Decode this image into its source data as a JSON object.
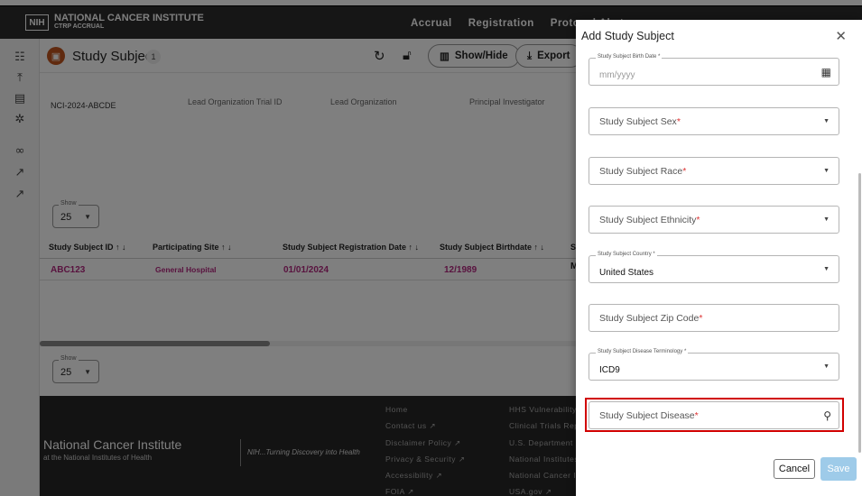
{
  "topbar": {
    "logo_box": "NIH",
    "logo_line1": "NATIONAL CANCER INSTITUTE",
    "logo_line2": "CTRP ACCRUAL",
    "nav": [
      "Accrual",
      "Registration",
      "Protocol Abst"
    ]
  },
  "sidebar_icons": [
    "search-list-icon",
    "upload-icon",
    "document-icon",
    "bug-icon",
    "link-icon",
    "external-link-icon",
    "external-link-icon"
  ],
  "subheader": {
    "title": "Study Subject",
    "count": "1",
    "show_hide": "Show/Hide",
    "export": "Export"
  },
  "trial_meta": {
    "trial_id": "NCI-2024-ABCDE",
    "labels": [
      "Lead Organization Trial ID",
      "Lead Organization",
      "Principal Investigator"
    ]
  },
  "show_control": {
    "label": "Show",
    "value": "25"
  },
  "table": {
    "headers": [
      "Study Subject ID",
      "Participating Site",
      "Study Subject Registration Date",
      "Study Subject Birthdate",
      "St"
    ],
    "rows": [
      [
        "ABC123",
        "General Hospital",
        "01/01/2024",
        "12/1989",
        "M"
      ]
    ]
  },
  "footer": {
    "title": "National Cancer Institute",
    "subtitle": "at the National Institutes of Health",
    "tagline": "NIH...Turning Discovery into Health",
    "col1": [
      "Home",
      "Contact us",
      "Disclaimer Policy",
      "Privacy & Security",
      "Accessibility",
      "FOIA"
    ],
    "col2": [
      "HHS Vulnerability",
      "Clinical Trials Rep",
      "U.S. Department o",
      "National Institutes",
      "National Cancer In",
      "USA.gov"
    ]
  },
  "dialog": {
    "title": "Add Study Subject",
    "birth_date": {
      "label": "Study Subject Birth Date *",
      "placeholder": "mm/yyyy"
    },
    "sex": "Study Subject Sex",
    "race": "Study Subject Race",
    "ethnicity": "Study Subject Ethnicity",
    "country": {
      "label": "Study Subject Country *",
      "value": "United States"
    },
    "zip": "Study Subject Zip Code",
    "terminology": {
      "label": "Study Subject Disease Terminology *",
      "value": "ICD9"
    },
    "disease": "Study Subject Disease",
    "required_mark": "*",
    "cancel": "Cancel",
    "save": "Save"
  },
  "colors": {
    "topbar": "#2c2c2c",
    "accent_magenta": "#b3267f",
    "highlight_red": "#d10000",
    "save_disabled": "#9ecbe9"
  }
}
